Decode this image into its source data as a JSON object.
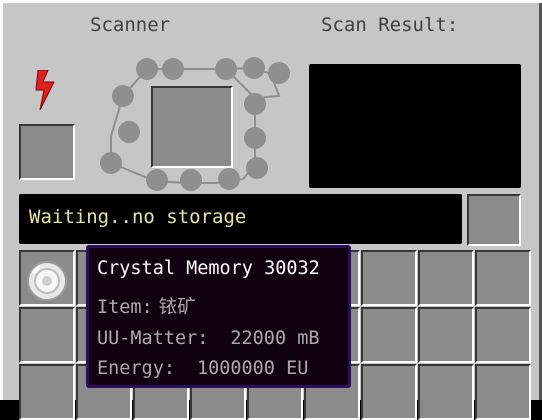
{
  "titles": {
    "scanner": "Scanner",
    "scan_result": "Scan Result:"
  },
  "status": {
    "text": "Waiting..no storage"
  },
  "tooltip": {
    "name": "Crystal Memory 30032",
    "item_label": "Item:",
    "item_value": "铱矿",
    "uu_label": "UU-Matter:",
    "uu_value": "22000 mB",
    "energy_label": "Energy:",
    "energy_value": "1000000 EU"
  },
  "colors": {
    "gui_background": "#c6c6c6",
    "slot": "#8b8b8b",
    "status_text": "#e6e6a0",
    "energy_icon": "#e02020",
    "tooltip_background": "#100010",
    "tooltip_border": "#2a0f5f"
  },
  "icons": {
    "energy": "red-lightning-bolt-icon",
    "scanner_ring": "scanner-dot-ring-icon",
    "stored_item": "crystal-memory-icon"
  }
}
